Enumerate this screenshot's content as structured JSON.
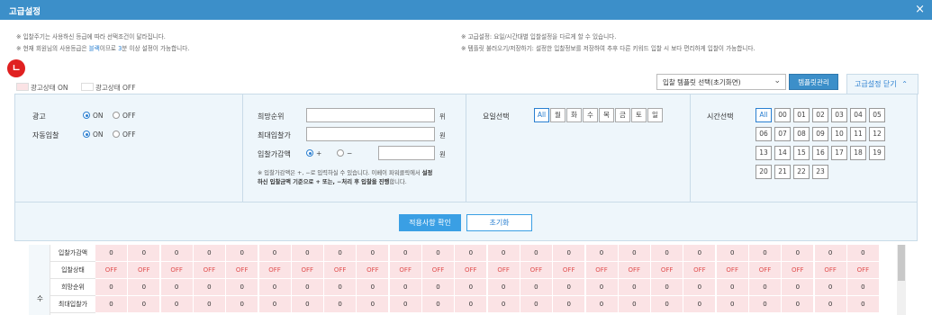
{
  "window": {
    "title": "고급설정",
    "close_icon": "×"
  },
  "notices": {
    "left1": "※ 입찰주기는 사용하신 등급에 따라 선택조건이 달라집니다.",
    "left2_pre": "※ 현재 회원님의 사용등급은 ",
    "left2_grade": "블랙",
    "left2_mid": "이므로 ",
    "left2_count": "3",
    "left2_post": "분 이상 설정이 가능합니다.",
    "right1": "※ 고급설정: 요일/시간대별 입찰설정을 다르게 할 수 있습니다.",
    "right2": "※ 템플릿 불러오기/저장하기: 설정한 입찰정보를 저장하여 추후 다른 키워드 입찰 시 보다 편리하게 입찰이 가능합니다."
  },
  "badge": "ㄴ",
  "legend": {
    "on": "광고상태 ON",
    "off": "광고상태 OFF",
    "on_color": "#fbe3e5",
    "off_color": "#ffffff"
  },
  "template": {
    "select_value": "입찰 템플릿 선택(초기화면)",
    "manage_button": "템플릿관리",
    "toggle_label": "고급설정 닫기"
  },
  "ad": {
    "label": "광고",
    "on": "ON",
    "off": "OFF"
  },
  "auto": {
    "label": "자동입찰",
    "on": "ON",
    "off": "OFF"
  },
  "bid": {
    "rank_label": "희망순위",
    "rank_unit": "위",
    "max_label": "최대입찰가",
    "max_unit": "원",
    "delta_label": "입찰가감액",
    "plus": "+",
    "minus": "−",
    "delta_unit": "원",
    "hint1": "※ 입찰가감액은 +, −로 입력하실 수 있습니다. 이베이 파워클릭에서 ",
    "hint_bold1": "설정하신 입찰금액 기준으로 + 또는, −처리 후 입찰을 진행",
    "hint2": "합니다."
  },
  "days": {
    "label": "요일선택",
    "items": [
      "All",
      "월",
      "화",
      "수",
      "목",
      "금",
      "토",
      "일"
    ]
  },
  "hours": {
    "label": "시간선택",
    "items": [
      "All",
      "00",
      "01",
      "02",
      "03",
      "04",
      "05",
      "06",
      "07",
      "08",
      "09",
      "10",
      "11",
      "12",
      "13",
      "14",
      "15",
      "16",
      "17",
      "18",
      "19",
      "20",
      "21",
      "22",
      "23"
    ]
  },
  "actions": {
    "apply": "적용사항 확인",
    "reset": "초기화"
  },
  "table": {
    "side_label": "수",
    "rows": [
      {
        "label": "입찰가감액",
        "values": [
          "0",
          "0",
          "0",
          "0",
          "0",
          "0",
          "0",
          "0",
          "0",
          "0",
          "0",
          "0",
          "0",
          "0",
          "0",
          "0",
          "0",
          "0",
          "0",
          "0",
          "0",
          "0",
          "0",
          "0"
        ]
      },
      {
        "label": "입찰상태",
        "values": [
          "OFF",
          "OFF",
          "OFF",
          "OFF",
          "OFF",
          "OFF",
          "OFF",
          "OFF",
          "OFF",
          "OFF",
          "OFF",
          "OFF",
          "OFF",
          "OFF",
          "OFF",
          "OFF",
          "OFF",
          "OFF",
          "OFF",
          "OFF",
          "OFF",
          "OFF",
          "OFF",
          "OFF"
        ]
      },
      {
        "label": "희망순위",
        "values": [
          "0",
          "0",
          "0",
          "0",
          "0",
          "0",
          "0",
          "0",
          "0",
          "0",
          "0",
          "0",
          "0",
          "0",
          "0",
          "0",
          "0",
          "0",
          "0",
          "0",
          "0",
          "0",
          "0",
          "0"
        ]
      },
      {
        "label": "최대입찰가",
        "values": [
          "0",
          "0",
          "0",
          "0",
          "0",
          "0",
          "0",
          "0",
          "0",
          "0",
          "0",
          "0",
          "0",
          "0",
          "0",
          "0",
          "0",
          "0",
          "0",
          "0",
          "0",
          "0",
          "0",
          "0"
        ]
      }
    ]
  }
}
